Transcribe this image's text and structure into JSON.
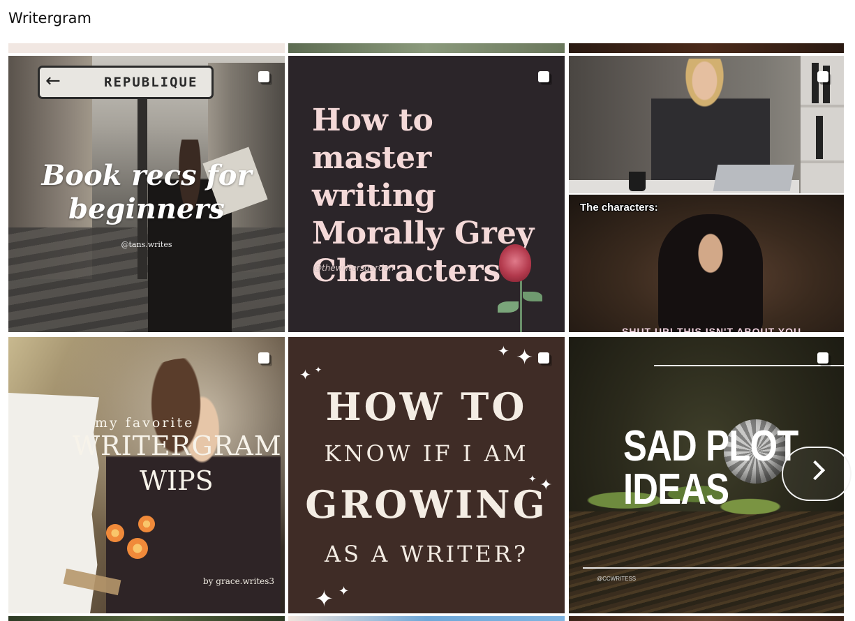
{
  "page": {
    "title": "Writergram"
  },
  "posts": [
    {
      "sign": "REPUBLIQUE",
      "caption_line1": "Book recs for",
      "caption_line2": "beginners",
      "handle": "@tans.writes"
    },
    {
      "heading_lines": [
        "How to master",
        "writing",
        "Morally Grey",
        "Characters"
      ],
      "handle": "@thewritersgarden"
    },
    {
      "bottom_label": "The characters:",
      "cut_caption": "SHUT UP! THIS ISN'T ABOUT YOU"
    },
    {
      "line1": "my favorite",
      "line2": "WRITERGRAM",
      "line3": "WIPS",
      "handle": "by grace.writes3"
    },
    {
      "lines": [
        "HOW TO",
        "KNOW IF I AM",
        "GROWING",
        "AS A WRITER?"
      ]
    },
    {
      "title_line1": "SAD PLOT",
      "title_line2": "IDEAS",
      "handle": "@CCWRITESS"
    }
  ],
  "icons": {
    "multi_post": "carousel-icon",
    "next": "chevron-right-icon"
  }
}
